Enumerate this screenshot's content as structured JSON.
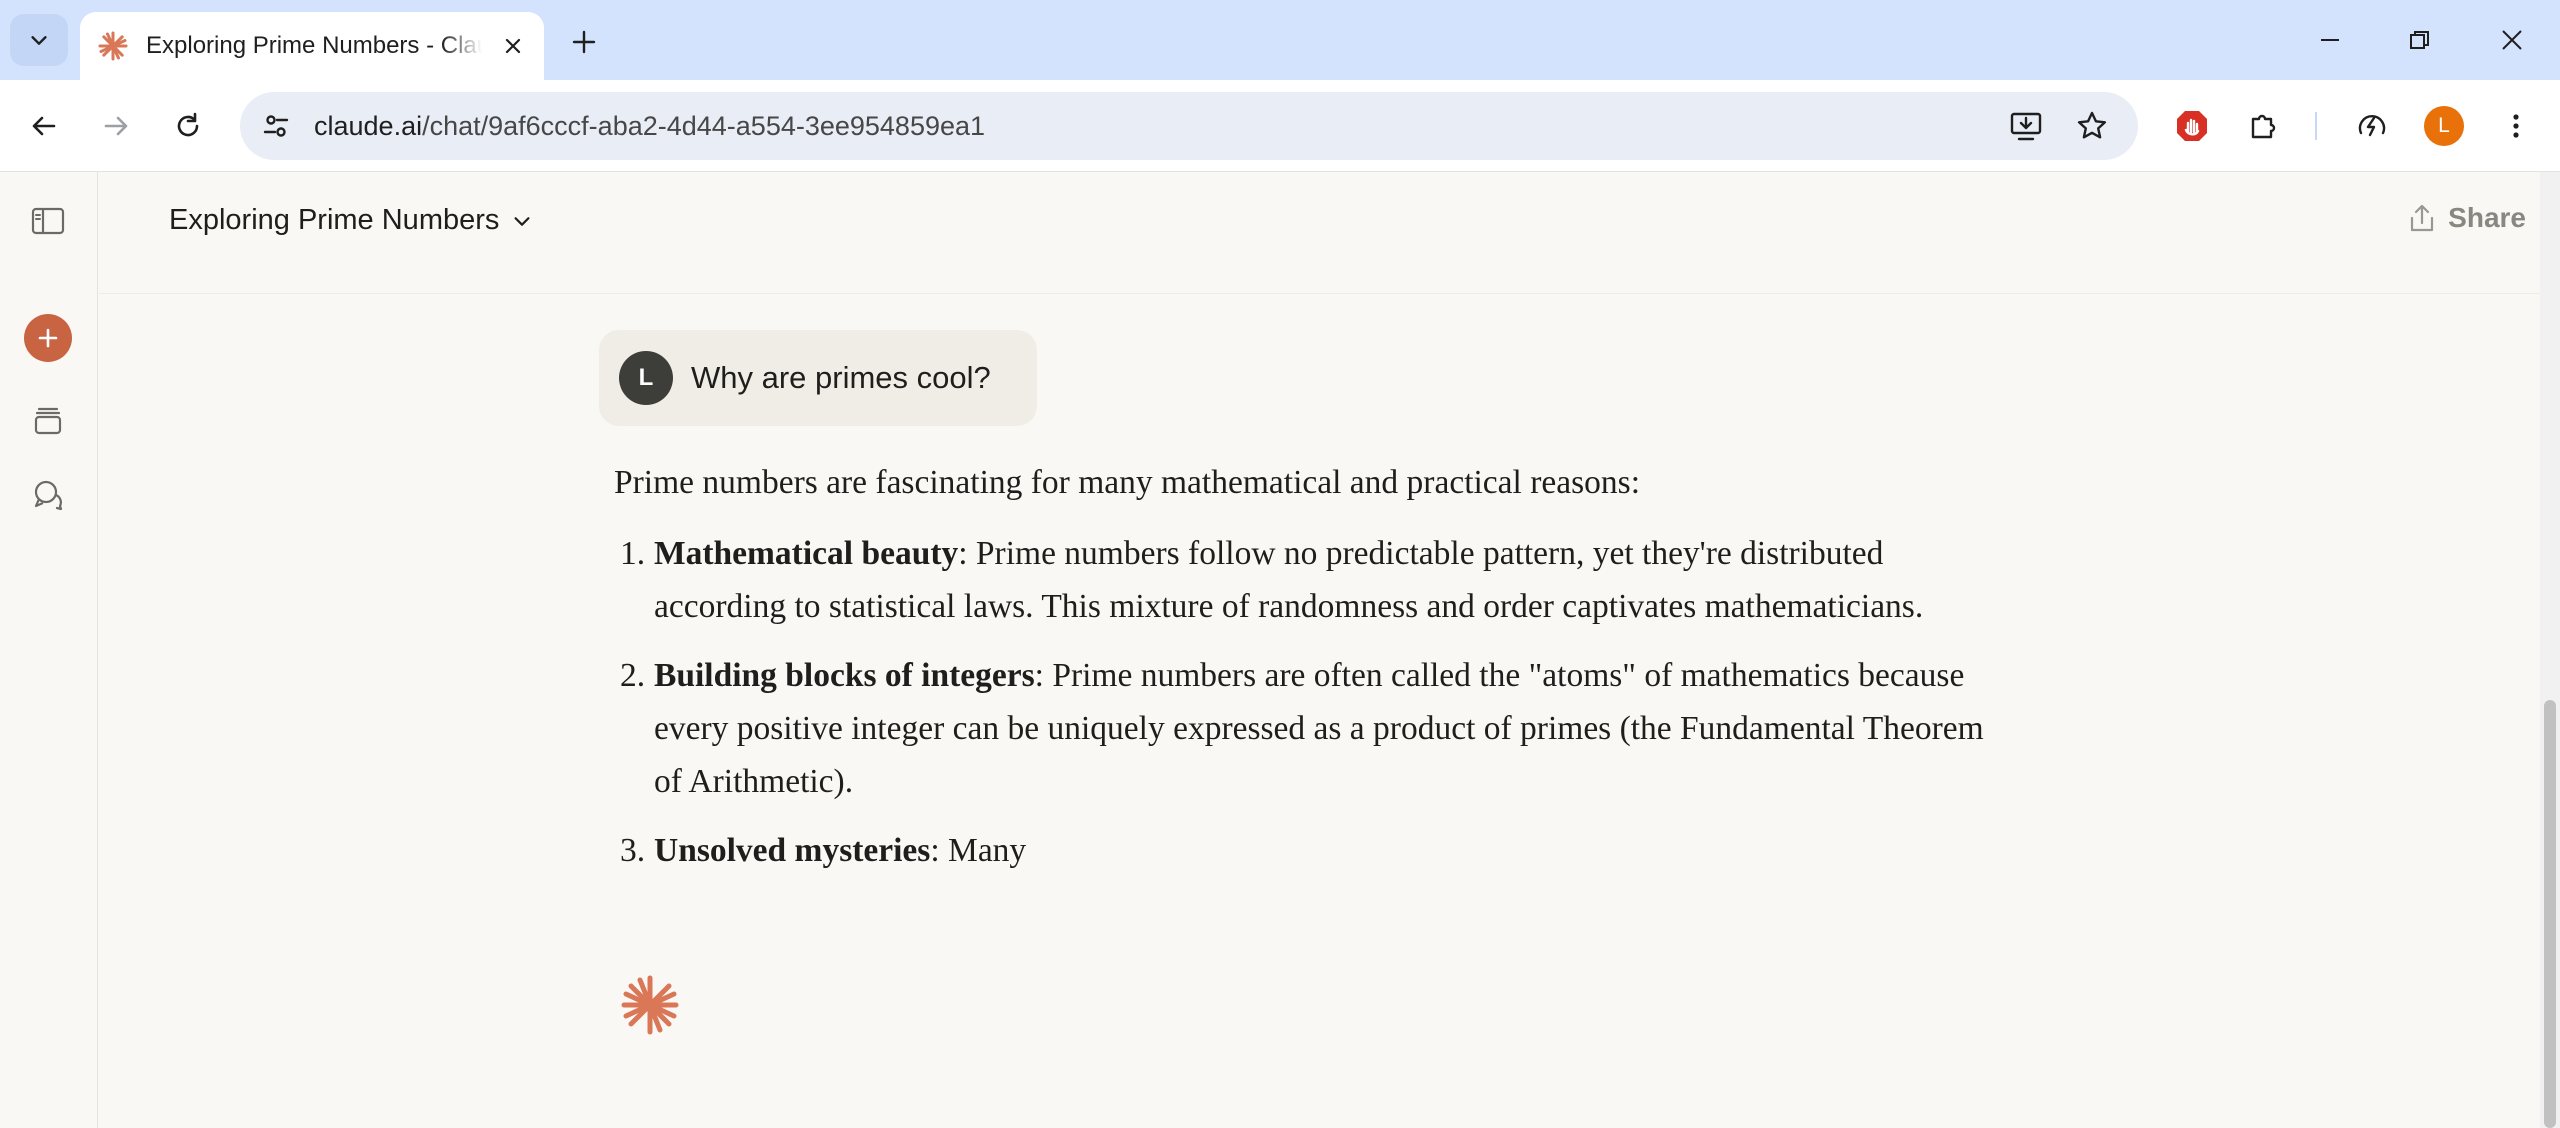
{
  "browser": {
    "tab_title": "Exploring Prime Numbers - Claude",
    "url_host": "claude.ai",
    "url_path": "/chat/9af6cccf-aba2-4d44-a554-3ee954859ea1",
    "profile_initial": "L",
    "colors": {
      "tabstrip": "#d3e3fd",
      "profile": "#e8710a",
      "extension_red": "#d93025"
    }
  },
  "header": {
    "title": "Exploring Prime Numbers",
    "share_label": "Share"
  },
  "sidebar": {
    "icons": [
      "sidebar-toggle-icon",
      "new-chat-icon",
      "projects-icon",
      "chats-icon"
    ],
    "accent": "#c96442"
  },
  "chat": {
    "user_initial": "L",
    "user_message": "Why are primes cool?",
    "response": {
      "intro": "Prime numbers are fascinating for many mathematical and practical reasons:",
      "items": [
        {
          "num": "1.",
          "title": "Mathematical beauty",
          "text": ": Prime numbers follow no predictable pattern, yet they're distributed according to statistical laws. This mixture of randomness and order captivates mathematicians."
        },
        {
          "num": "2.",
          "title": "Building blocks of integers",
          "text": ": Prime numbers are often called the \"atoms\" of mathematics because every positive integer can be uniquely expressed as a product of primes (the Fundamental Theorem of Arithmetic)."
        },
        {
          "num": "3.",
          "title": "Unsolved mysteries",
          "text": ": Many"
        }
      ]
    }
  }
}
